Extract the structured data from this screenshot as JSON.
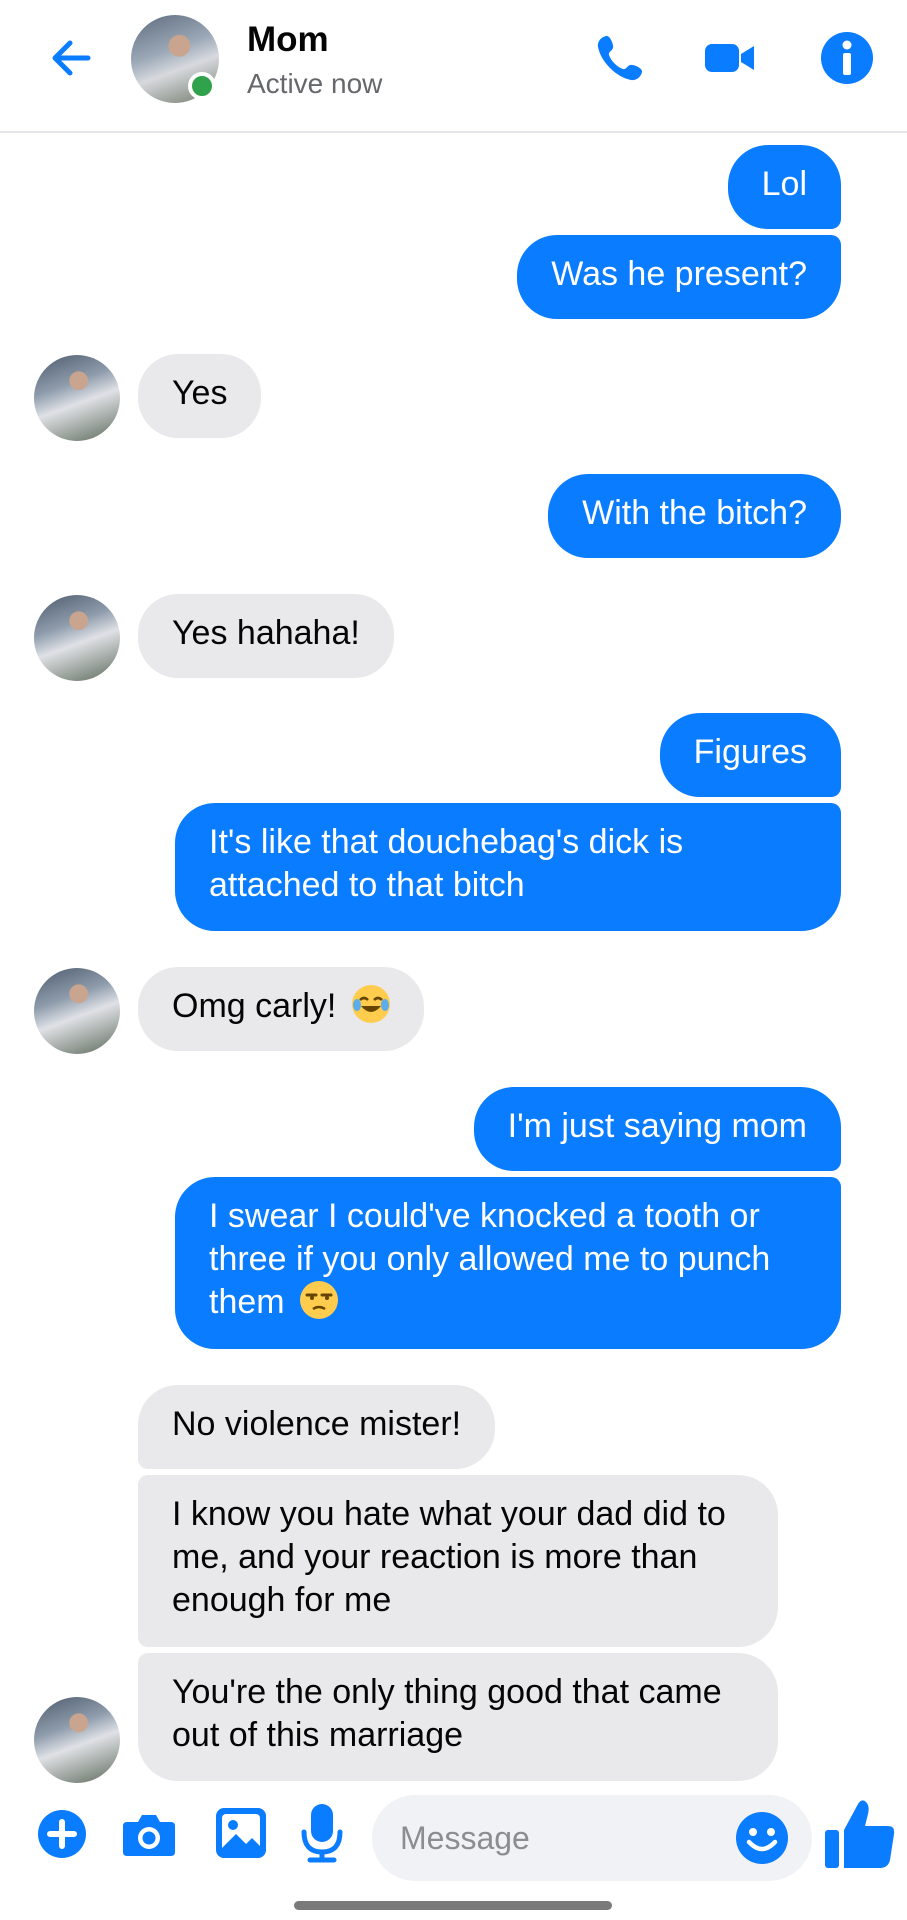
{
  "header": {
    "contact_name": "Mom",
    "status": "Active now",
    "icons": [
      "back-arrow-icon",
      "phone-icon",
      "video-camera-icon",
      "info-icon"
    ]
  },
  "messages": [
    {
      "from": "me",
      "text": "Lol"
    },
    {
      "from": "me",
      "text": "Was he present?"
    },
    {
      "from": "mom",
      "text": "Yes"
    },
    {
      "from": "me",
      "text": "With the bitch?"
    },
    {
      "from": "mom",
      "text": "Yes hahaha!"
    },
    {
      "from": "me",
      "text": "Figures"
    },
    {
      "from": "me",
      "text": "It's like that douchebag's dick is attached to that bitch"
    },
    {
      "from": "mom",
      "text": "Omg carly!",
      "emoji": "tears-of-joy-emoji"
    },
    {
      "from": "me",
      "text": "I'm just saying mom"
    },
    {
      "from": "me",
      "text": "I swear I could've knocked a tooth or three if you only allowed me to punch them",
      "emoji": "unamused-face-emoji"
    },
    {
      "from": "mom",
      "text": "No violence mister!"
    },
    {
      "from": "mom",
      "text": "I know you hate what your dad did to me, and your reaction is more than enough for me"
    },
    {
      "from": "mom",
      "text": "You're the only thing good that came out of this marriage"
    }
  ],
  "composer": {
    "placeholder": "Message",
    "icons": [
      "plus-icon",
      "camera-icon",
      "gallery-icon",
      "microphone-icon",
      "emoji-icon",
      "thumbs-up-icon"
    ]
  },
  "colors": {
    "accent": "#0a7cff",
    "incoming_bubble": "#e9e9eb",
    "online": "#31a24c"
  }
}
